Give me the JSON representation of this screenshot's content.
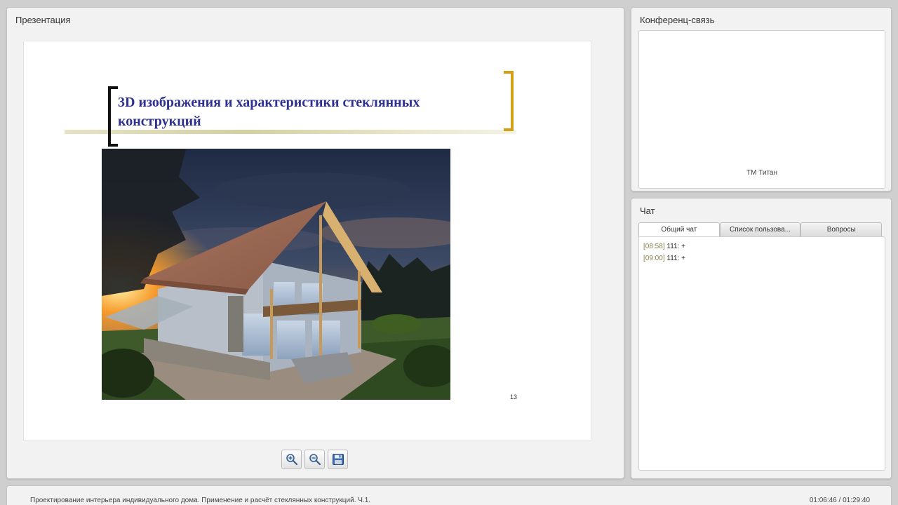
{
  "presentation": {
    "panel_title": "Презентация",
    "slide": {
      "title": "3D изображения и характеристики стеклянных конструкций",
      "page_number": "13",
      "accent_colors": {
        "left_bracket": "#111111",
        "right_bracket": "#d4a017",
        "title": "#2e3192"
      }
    },
    "toolbar": {
      "zoom_in_icon": "zoom-in-icon",
      "zoom_out_icon": "zoom-out-icon",
      "save_icon": "floppy-disk-icon"
    }
  },
  "conference": {
    "panel_title": "Конференц-связь",
    "participant_name": "ТМ Титан"
  },
  "chat": {
    "panel_title": "Чат",
    "tabs": [
      {
        "label": "Общий чат",
        "active": true
      },
      {
        "label": "Список пользова...",
        "active": false
      },
      {
        "label": "Вопросы",
        "active": false
      }
    ],
    "messages": [
      {
        "time": "[08:58]",
        "user": "111:",
        "text": "+"
      },
      {
        "time": "[09:00]",
        "user": "111:",
        "text": "+"
      }
    ]
  },
  "footer": {
    "title": "Проектирование интерьера индивидуального дома. Применение и расчёт стеклянных конструкций. Ч.1.",
    "time": "01:06:46 / 01:29:40"
  }
}
